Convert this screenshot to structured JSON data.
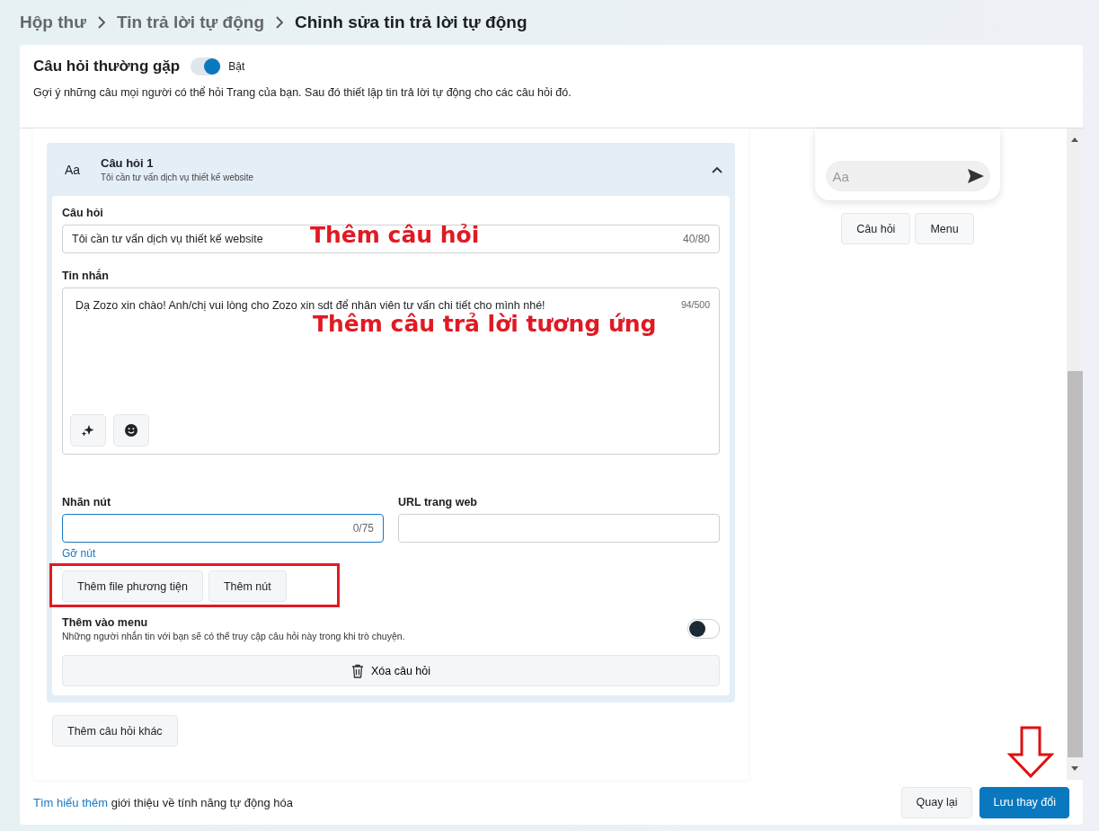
{
  "breadcrumb": [
    "Hộp thư",
    "Tin trả lời tự động",
    "Chỉnh sửa tin trả lời tự động"
  ],
  "faq": {
    "title": "Câu hỏi thường gặp",
    "on": true,
    "toggle_label": "Bật",
    "description": "Gợi ý những câu mọi người có thể hỏi Trang của bạn. Sau đó thiết lập tin trả lời tự động cho các câu hỏi đó."
  },
  "question": {
    "icon_text": "Aa",
    "title": "Câu hỏi 1",
    "subtitle": "Tôi cần tư vấn dịch vụ thiết kế website",
    "expanded": true,
    "question_label": "Câu hỏi",
    "question_value": "Tôi cần tư vấn dịch vụ thiết kế website",
    "question_count": "40/80",
    "message_label": "Tin nhắn",
    "message_value": "Dạ Zozo xin chào! Anh/chị vui lòng cho Zozo xin sdt để nhân viên tư vấn chi tiết cho mình nhé!",
    "message_count": "94/500",
    "button_label": "Nhãn nút",
    "button_count": "0/75",
    "url_label": "URL trang web",
    "remove_button_link": "Gỡ nút",
    "actions": [
      "Thêm file phương tiện",
      "Thêm nút"
    ],
    "menu_title": "Thêm vào menu",
    "menu_description": "Những người nhắn tin với bạn sẽ có thể truy cập câu hỏi này trong khi trò chuyện.",
    "menu_on": false,
    "delete_label": "Xóa câu hỏi"
  },
  "add_question": "Thêm câu hỏi khác",
  "preview": {
    "input_placeholder": "Aa",
    "chips": [
      "Câu hỏi",
      "Menu"
    ]
  },
  "annotations": [
    "Thêm câu hỏi",
    "Thêm câu trả lời tương ứng"
  ],
  "footer": {
    "link": "Tìm hiểu thêm",
    "text": "giới thiệu về tính năng tự động hóa",
    "buttons": [
      "Quay lại",
      "Lưu thay đổi"
    ]
  }
}
